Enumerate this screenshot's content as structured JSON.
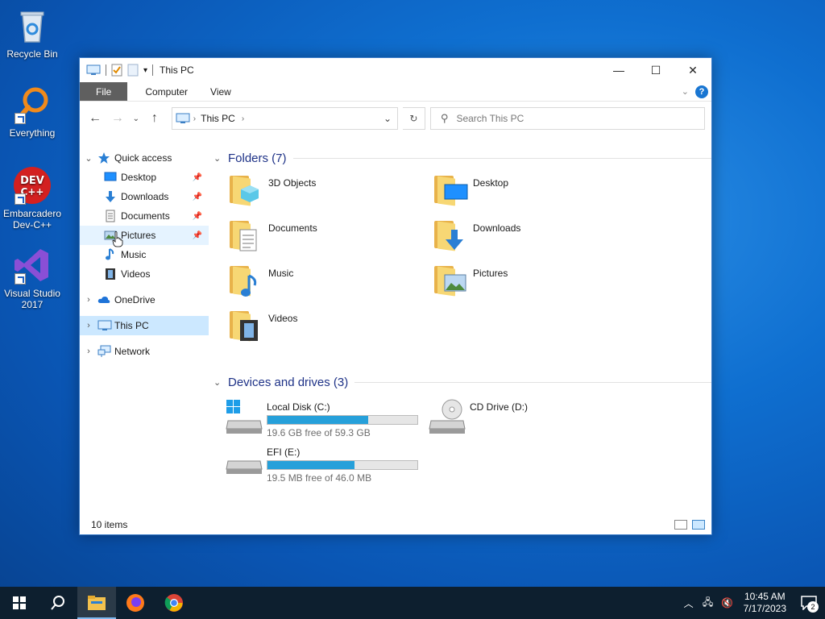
{
  "desktop": {
    "icons": [
      {
        "label": "Recycle Bin"
      },
      {
        "label": "Everything"
      },
      {
        "label": "Embarcadero Dev-C++"
      },
      {
        "label": "Visual Studio 2017"
      }
    ]
  },
  "window": {
    "title": "This PC",
    "controls": {
      "minimize": "—",
      "maximize": "☐",
      "close": "✕"
    }
  },
  "ribbon": {
    "tabs": [
      "File",
      "Computer",
      "View"
    ]
  },
  "navbar": {
    "breadcrumb": "This PC",
    "search_placeholder": "Search This PC"
  },
  "navpane": {
    "quick_access": "Quick access",
    "quick_items": [
      "Desktop",
      "Downloads",
      "Documents",
      "Pictures",
      "Music",
      "Videos"
    ],
    "onedrive": "OneDrive",
    "thispc": "This PC",
    "network": "Network"
  },
  "content": {
    "folders_header": "Folders (7)",
    "folders": [
      "3D Objects",
      "Desktop",
      "Documents",
      "Downloads",
      "Music",
      "Pictures",
      "Videos"
    ],
    "drives_header": "Devices and drives (3)",
    "drives": [
      {
        "name": "Local Disk (C:)",
        "free": "19.6 GB free of 59.3 GB",
        "used_fraction": 0.67
      },
      {
        "name": "CD Drive (D:)"
      },
      {
        "name": "EFI (E:)",
        "free": "19.5 MB free of 46.0 MB",
        "used_fraction": 0.58
      }
    ]
  },
  "statusbar": {
    "items": "10 items"
  },
  "taskbar": {
    "time": "10:45 AM",
    "date": "7/17/2023",
    "notifications": "2"
  },
  "colors": {
    "accent": "#26a0da",
    "file_tab": "#5f5f5f",
    "selected": "#cce8ff",
    "taskbar": "#0d1f2f"
  }
}
